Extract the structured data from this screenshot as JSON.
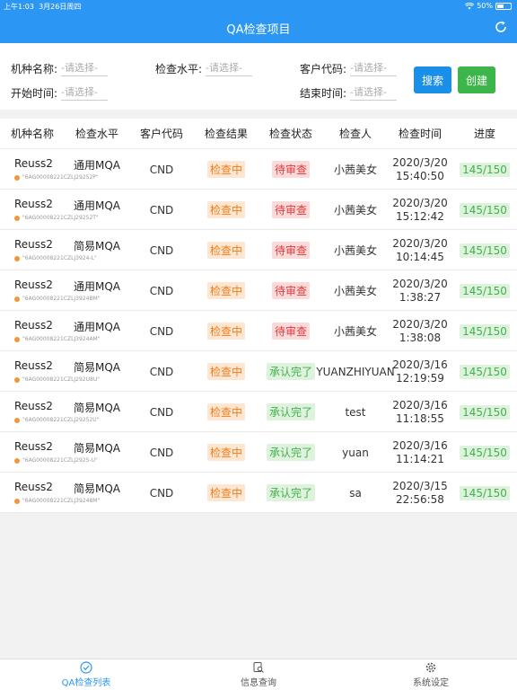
{
  "status": {
    "time": "上午1:03",
    "date": "3月26日周四",
    "battery": "50%",
    "battery_level": 0.5
  },
  "header": {
    "title": "QA检查项目"
  },
  "filters": {
    "model_label": "机种名称:",
    "model_value": "-请选择-",
    "level_label": "检查水平:",
    "level_value": "-请选择-",
    "customer_label": "客户代码:",
    "customer_value": "-请选择-",
    "start_label": "开始时间:",
    "start_value": "-请选择-",
    "end_label": "结束时间:",
    "end_value": "-请选择-",
    "search_label": "搜索",
    "create_label": "创建"
  },
  "table": {
    "headers": [
      "机种名称",
      "检查水平",
      "客户代码",
      "检查结果",
      "检查状态",
      "检查人",
      "检查时间",
      "进度"
    ],
    "rows": [
      {
        "name": "Reuss2",
        "code": "\"6AG00008221CZLJ29252P\"",
        "level": "通用MQA",
        "customer": "CND",
        "result": "检查中",
        "state": "待审查",
        "state_type": "red",
        "inspector": "小茜美女",
        "date": "2020/3/20",
        "clock": "15:40:50",
        "progress": "145/150"
      },
      {
        "name": "Reuss2",
        "code": "\"6AG00008221CZLJ29252T\"",
        "level": "通用MQA",
        "customer": "CND",
        "result": "检查中",
        "state": "待审查",
        "state_type": "red",
        "inspector": "小茜美女",
        "date": "2020/3/20",
        "clock": "15:12:42",
        "progress": "145/150"
      },
      {
        "name": "Reuss2",
        "code": "\"6AG00008221CZLJ3924-L\"",
        "level": "简易MQA",
        "customer": "CND",
        "result": "检查中",
        "state": "待审查",
        "state_type": "red",
        "inspector": "小茜美女",
        "date": "2020/3/20",
        "clock": "10:14:45",
        "progress": "145/150"
      },
      {
        "name": "Reuss2",
        "code": "\"6AG00008221CZLJ3924BM\"",
        "level": "通用MQA",
        "customer": "CND",
        "result": "检查中",
        "state": "待审查",
        "state_type": "red",
        "inspector": "小茜美女",
        "date": "2020/3/20",
        "clock": "1:38:27",
        "progress": "145/150"
      },
      {
        "name": "Reuss2",
        "code": "\"6AG00008221CZLJ3924AM\"",
        "level": "通用MQA",
        "customer": "CND",
        "result": "检查中",
        "state": "待审查",
        "state_type": "red",
        "inspector": "小茜美女",
        "date": "2020/3/20",
        "clock": "1:38:08",
        "progress": "145/150"
      },
      {
        "name": "Reuss2",
        "code": "\"6AG00008221CZLJ292U8U\"",
        "level": "简易MQA",
        "customer": "CND",
        "result": "检查中",
        "state": "承认完了",
        "state_type": "green",
        "inspector": "YUANZHIYUAN",
        "date": "2020/3/16",
        "clock": "12:19:59",
        "progress": "145/150"
      },
      {
        "name": "Reuss2",
        "code": "\"6AG00008221CZLJ29252U\"",
        "level": "简易MQA",
        "customer": "CND",
        "result": "检查中",
        "state": "承认完了",
        "state_type": "green",
        "inspector": "test",
        "date": "2020/3/16",
        "clock": "11:18:55",
        "progress": "145/150"
      },
      {
        "name": "Reuss2",
        "code": "\"6AG00008221CZLJ2925-U\"",
        "level": "简易MQA",
        "customer": "CND",
        "result": "检查中",
        "state": "承认完了",
        "state_type": "green",
        "inspector": "yuan",
        "date": "2020/3/16",
        "clock": "11:14:21",
        "progress": "145/150"
      },
      {
        "name": "Reuss2",
        "code": "\"6AG00008221CZLJ39248M\"",
        "level": "简易MQA",
        "customer": "CND",
        "result": "检查中",
        "state": "承认完了",
        "state_type": "green",
        "inspector": "sa",
        "date": "2020/3/15",
        "clock": "22:56:58",
        "progress": "145/150"
      }
    ]
  },
  "tabbar": {
    "tab1": "QA检查列表",
    "tab2": "信息查询",
    "tab3": "系统设定"
  },
  "colors": {
    "primary": "#2b96f3",
    "create": "#3cb54a",
    "pending": "#e0393b",
    "approved": "#3fb24a",
    "checking": "#f07d1a"
  }
}
